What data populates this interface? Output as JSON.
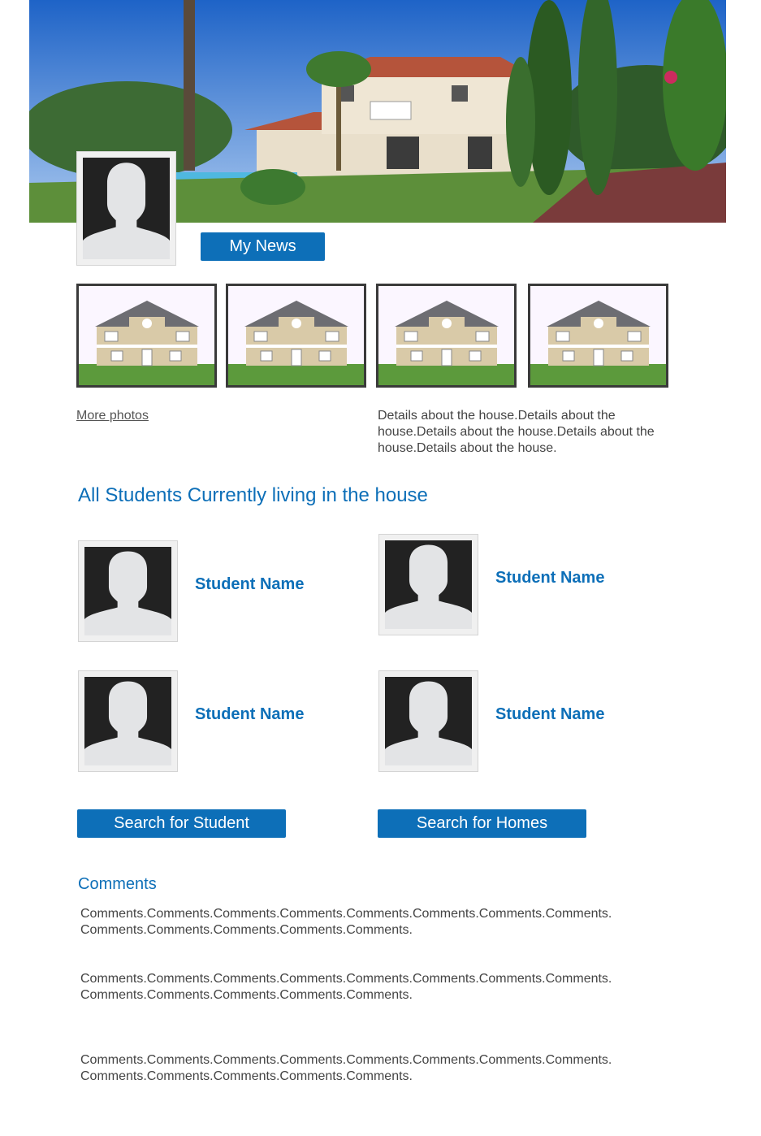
{
  "profile": {
    "my_news_label": "My News"
  },
  "photos": {
    "more_photos_label": "More photos",
    "details": "Details about the house.Details about the house.Details about the house.Details about the house.Details about the house."
  },
  "students": {
    "title": "All Students Currently living in the house",
    "names": [
      "Student Name",
      "Student Name",
      "Student Name",
      "Student Name"
    ]
  },
  "actions": {
    "search_student_label": "Search for Student",
    "search_homes_label": "Search for Homes"
  },
  "comments": {
    "title": "Comments",
    "items": [
      "Comments.Comments.Comments.Comments.Comments.Comments.Comments.Comments. Comments.Comments.Comments.Comments.Comments.",
      "Comments.Comments.Comments.Comments.Comments.Comments.Comments.Comments. Comments.Comments.Comments.Comments.Comments.",
      "Comments.Comments.Comments.Comments.Comments.Comments.Comments.Comments. Comments.Comments.Comments.Comments.Comments."
    ]
  },
  "colors": {
    "accent": "#0d6fb8",
    "text": "#444444"
  }
}
